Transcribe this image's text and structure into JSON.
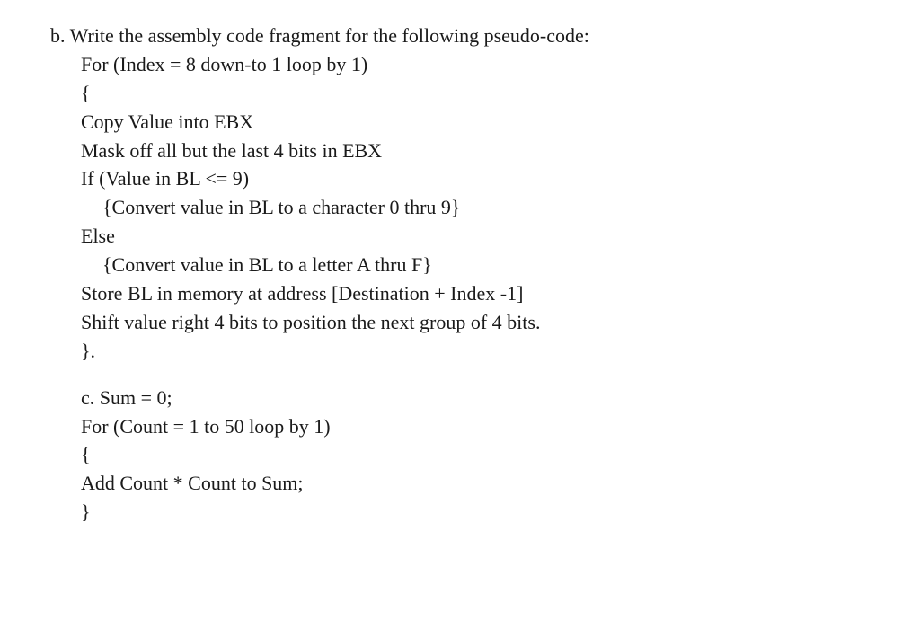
{
  "lines": {
    "b_label": "b. Write the assembly code fragment for the following pseudo-code:",
    "for_index": "For (Index = 8 down-to 1 loop by 1)",
    "open_brace": "{",
    "copy_value": "Copy Value into EBX",
    "mask_off": "Mask off all but the last 4 bits in EBX",
    "if_value": "If (Value in BL <= 9)",
    "convert_09": "{Convert value in BL to a character 0 thru 9}",
    "else_kw": "Else",
    "convert_af": "{Convert value in BL to a letter A thru F}",
    "store_bl": "Store BL in memory at address [Destination + Index -1]",
    "shift_val": "Shift value right 4 bits to position the next group of 4 bits.",
    "close_brace": "}.",
    "c_label": "c. Sum = 0;",
    "for_count": "For (Count = 1 to 50 loop by 1)",
    "open_brace2": "{",
    "add_count": "Add Count * Count to Sum;",
    "close_brace2": "}"
  }
}
